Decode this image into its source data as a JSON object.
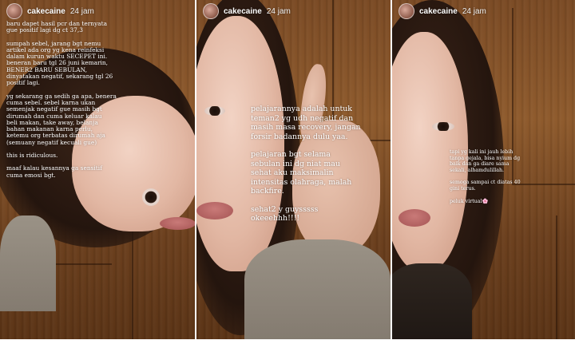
{
  "stories": [
    {
      "username": "cakecaine",
      "time": "24 jam",
      "paragraphs": [
        "baru dapet hasil pcr dan ternyata\ngue positif lagi dg ct 37,3",
        "sumpah sebel, jarang bgt nemu\nartikel ada org yg kena reinfeksi\ndalam kurun waktu SECEPET ini.\nbeneran baru tgl 26 juni kemarin,\nBENER2 BARU SEBULAN,\ndinyatakan negatif, sekarang tgl 26\npositif lagi.",
        "yg sekarang ga sedih ga apa, benera\ncuma sebel. sebel karna ukan\nsemenjak negatif gue masih bgt\ndirumah dan cuma keluar kalau\nbeli makan, take away, belanja\nbahan makanan karna perlu,\nketemu org terbatas dirumah aja\n(semuany negatif kecuali gue)",
        "this is ridiculous.",
        "maaf kalau kesannya ga sensitif\ncuma emosi bgt."
      ]
    },
    {
      "username": "cakecaine",
      "time": "24 jam",
      "paragraphs": [
        "pelajarannya adalah untuk\nteman2 yg udh negatif dan\nmasih masa recovery, jangan\nforsir badannya dulu yaa.",
        "pelajaran bgt selama\nsebulan ini dg niat mau\nsehat aku maksimalin\nintensitas olahraga, malah\nbackfire.",
        "sehat2 y guysssss\nokeeehhh!!!!"
      ]
    },
    {
      "username": "cakecaine",
      "time": "24 jam",
      "paragraphs": [
        "tapi yg kali ini jauh lebih\ntanpa gejala, bisa nyium dg\nbaik dan ga diare sama\nsekali, alhamdulillah.",
        "semoga sampai ct diatas 40\ngini terus.",
        "peluk virtual"
      ],
      "last_emoji": "🌸"
    }
  ],
  "icons": {
    "avatar": "profile-avatar",
    "emoji": "cherry-blossom"
  }
}
